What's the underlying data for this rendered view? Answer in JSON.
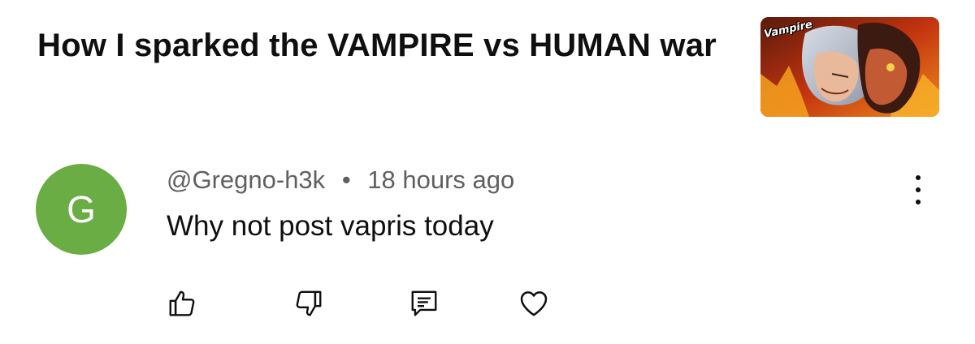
{
  "video": {
    "title": "How I sparked the VAMPIRE vs HUMAN war",
    "thumbnail_logo": "Vampire"
  },
  "comment": {
    "avatar_letter": "G",
    "avatar_color": "#6bad45",
    "author": "@Gregno-h3k",
    "separator": "•",
    "time": "18 hours ago",
    "text": "Why not post vapris today"
  },
  "actions": {
    "like_icon": "thumbs-up-icon",
    "dislike_icon": "thumbs-down-icon",
    "reply_icon": "reply-icon",
    "heart_icon": "heart-icon",
    "more_icon": "more-vertical-icon"
  },
  "colors": {
    "text": "#0f0f0f",
    "secondary_text": "#606060",
    "background": "#ffffff"
  }
}
